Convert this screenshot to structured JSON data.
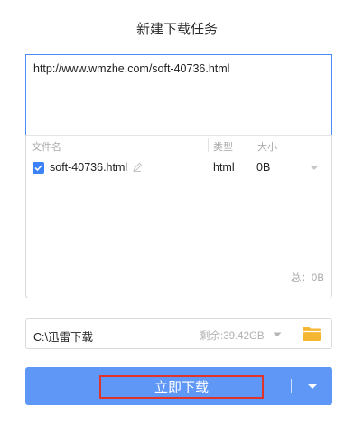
{
  "dialog": {
    "title": "新建下载任务"
  },
  "url_input": {
    "value": "http://www.wmzhe.com/soft-40736.html"
  },
  "file_list": {
    "headers": {
      "name": "文件名",
      "type": "类型",
      "size": "大小"
    },
    "rows": [
      {
        "name": "soft-40736.html",
        "type": "html",
        "size": "0B",
        "checked": true
      }
    ],
    "total": "总：0B"
  },
  "save_path": {
    "path": "C:\\迅雷下载",
    "free_space": "剩余:39.42GB"
  },
  "download_button": {
    "label": "立即下载"
  },
  "colors": {
    "accent": "#5f97f7",
    "checkbox": "#3b82f6",
    "highlight_border": "#e0342a",
    "folder": "#f5b731"
  },
  "icons": [
    "edit-icon",
    "chevron-down-icon",
    "folder-icon",
    "check-icon"
  ]
}
